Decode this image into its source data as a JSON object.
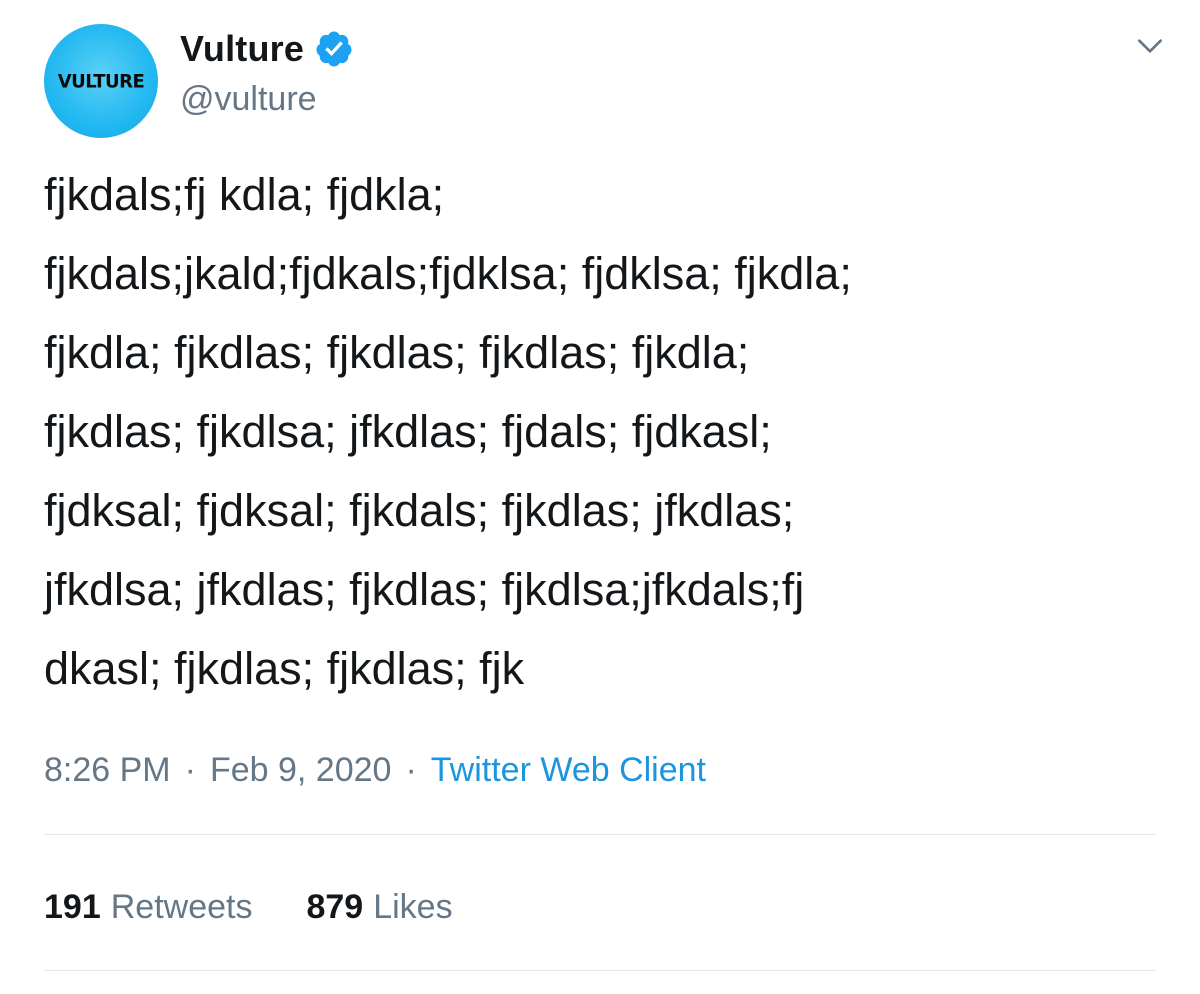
{
  "tweet": {
    "author": {
      "display_name": "Vulture",
      "handle": "@vulture",
      "avatar_text": "VULTURE",
      "verified": true
    },
    "body_lines": [
      "fjkdals;fj kdla; fjdkla;",
      "fjkdals;jkald;fjdkals;fjdklsa; fjdklsa; fjkdla;",
      "fjkdla; fjkdlas; fjkdlas; fjkdlas; fjkdla;",
      "fjkdlas; fjkdlsa; jfkdlas; fjdals; fjdkasl;",
      "fjdksal; fjdksal; fjkdals; fjkdlas; jfkdlas;",
      "jfkdlsa; jfkdlas; fjkdlas; fjkdlsa;jfkdals;fj",
      "dkasl; fjkdlas; fjkdlas; fjk"
    ],
    "time": "8:26 PM",
    "separator": "·",
    "date": "Feb 9, 2020",
    "source": "Twitter Web Client",
    "stats": {
      "retweets_count": "191",
      "retweets_label": "Retweets",
      "likes_count": "879",
      "likes_label": "Likes"
    }
  },
  "icons": {
    "verified": "verified-badge-icon",
    "menu": "chevron-down-icon"
  },
  "colors": {
    "text_primary": "#14171a",
    "text_secondary": "#657786",
    "link": "#1b95e0",
    "verified": "#1da1f2",
    "avatar_bg": "#22b8f0",
    "divider": "#e1e8ed"
  }
}
